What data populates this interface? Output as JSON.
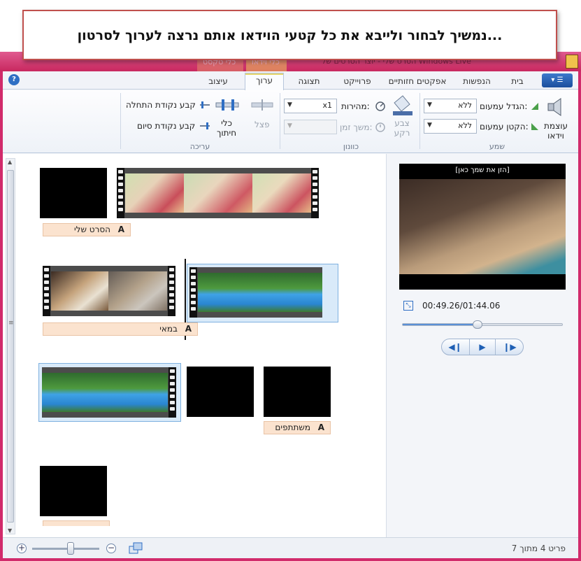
{
  "banner": {
    "text": "נמשיך לבחור ולייבא את כל קטעי הוידאו אותם נרצה לערוך לסרטון..."
  },
  "titlebar": {
    "window_title": "הסרט שלי - יוצר הסרטים של Windows Live",
    "context_tab_video": "כלי וידאו",
    "context_tab_text": "כלי טקסט"
  },
  "tabs": [
    {
      "label": "בית"
    },
    {
      "label": "הנפשות"
    },
    {
      "label": "אפקטים חזותיים"
    },
    {
      "label": "פרוייקט"
    },
    {
      "label": "תצוגה"
    },
    {
      "label": "ערוך"
    },
    {
      "label": "עיצוב"
    }
  ],
  "ribbon": {
    "audio_group": {
      "label": "שמע",
      "video_volume": "עוצמת וידאו",
      "fade_in_label": "הגדל עמעום:",
      "fade_in_value": "ללא",
      "fade_out_label": "הקטן עמעום:",
      "fade_out_value": "ללא"
    },
    "adjust_group": {
      "label": "כוונון",
      "bg_color": "צבע רקע",
      "speed_label": "מהירות:",
      "speed_value": "x1",
      "duration_label": "משך זמן:"
    },
    "edit_group": {
      "label": "עריכה",
      "split": "פצל",
      "trim_tool": "כלי חיתוך",
      "set_start": "קבע נקודת התחלה",
      "set_end": "קבע נקודת סיום"
    }
  },
  "storyboard": {
    "captions": [
      "הסרט שלי",
      "במאי",
      "משתתפים"
    ]
  },
  "preview": {
    "overlay_text": "[הזן את שמך כאן]",
    "timecode": "00:49.26/01:44.06",
    "progress": 0.47
  },
  "status": {
    "item_count": "פריט 4 מתוך 7",
    "zoom_level": 0.5
  },
  "colors": {
    "window_frame": "#d12b6b",
    "caption_bg": "#fbe3cf",
    "selection": "#d9eaf9",
    "accent": "#2f6fc4"
  }
}
